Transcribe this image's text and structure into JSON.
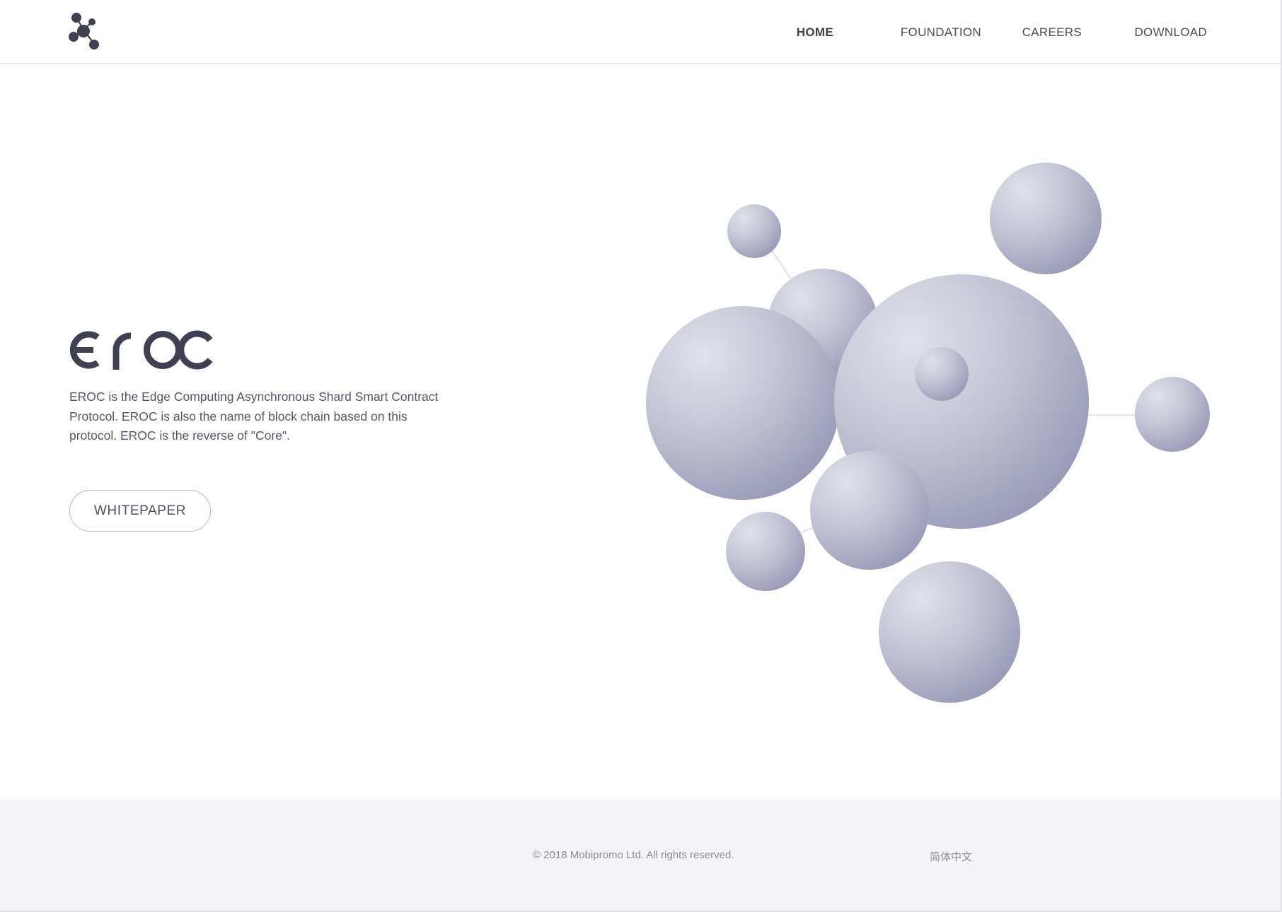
{
  "header": {
    "logo_icon": "molecule-logo-icon",
    "nav": [
      {
        "label": "HOME",
        "active": true
      },
      {
        "label": "FOUNDATION",
        "active": false
      },
      {
        "label": "CAREERS",
        "active": false
      },
      {
        "label": "DOWNLOAD",
        "active": false
      }
    ]
  },
  "hero": {
    "wordmark": "eroc",
    "description": "EROC is the Edge Computing Asynchronous Shard Smart Contract Protocol. EROC is also the name of block chain based on this protocol. EROC is the reverse of \"Core\".",
    "button_label": "WHITEPAPER",
    "illustration_icon": "sphere-cluster-illustration"
  },
  "footer": {
    "copyright": "© 2018 Mobipromo Ltd. All rights reserved.",
    "language_link": "简体中文"
  },
  "colors": {
    "brand_dark": "#3f4052",
    "text": "#55566a",
    "sphere_light": "#dde0e8",
    "sphere_dark": "#9a9bb8",
    "footer_bg": "#f5f5f7"
  }
}
